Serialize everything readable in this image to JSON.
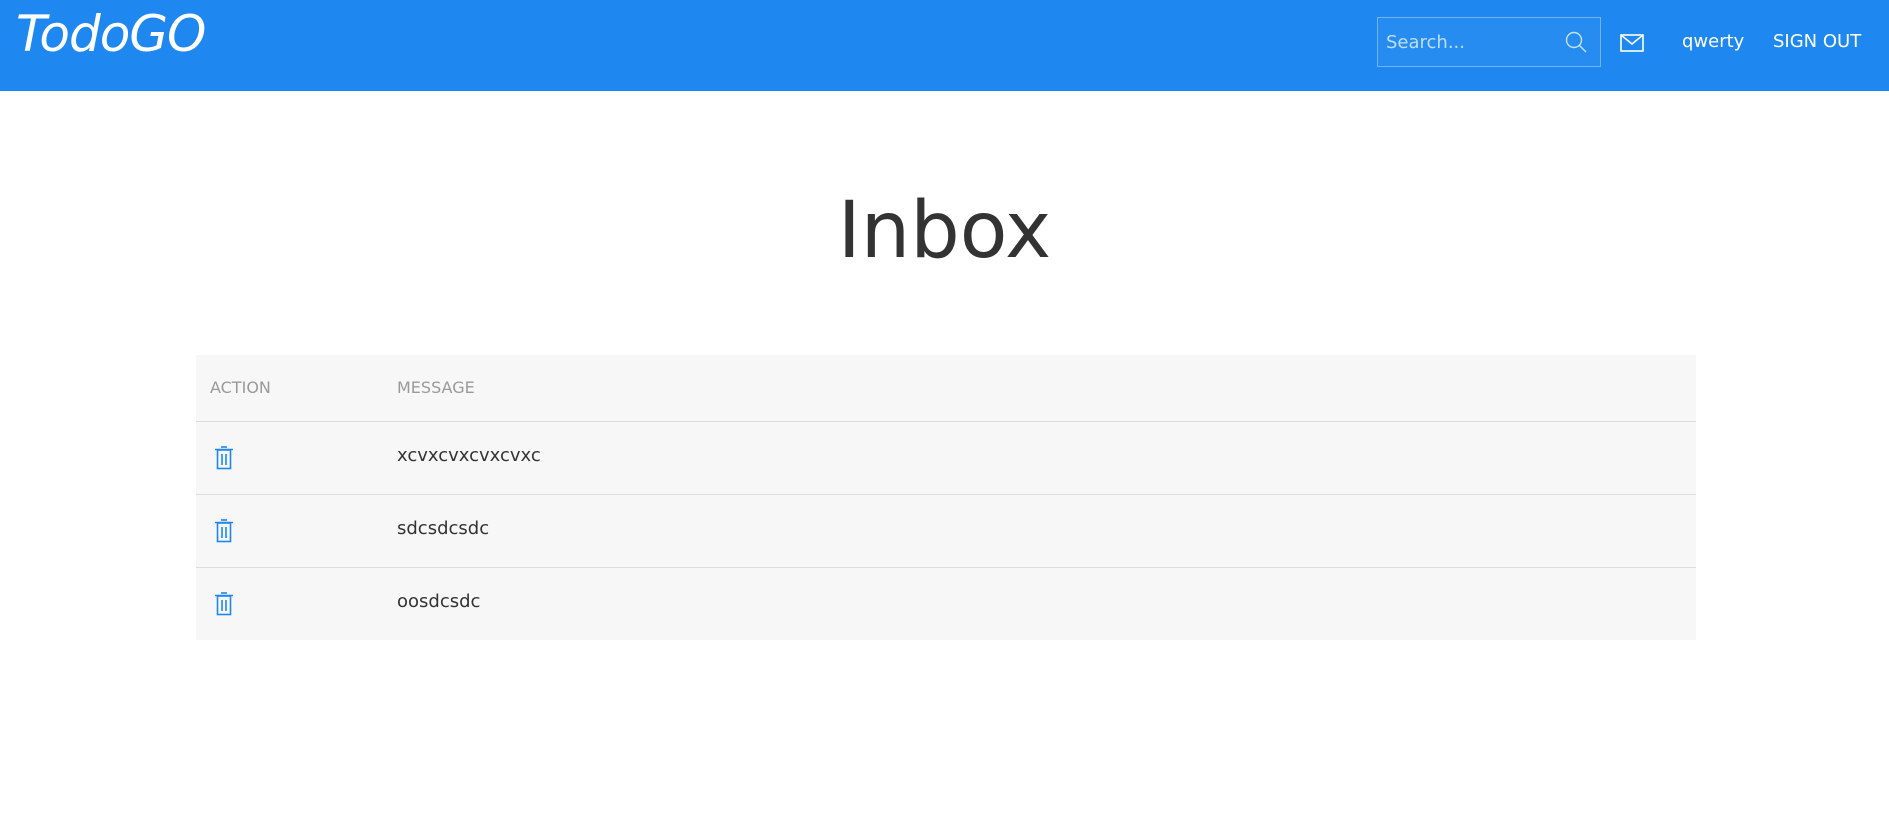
{
  "header": {
    "brand": "TodoGO",
    "search_placeholder": "Search...",
    "search_icon": "search-icon",
    "mail_icon": "mail-icon",
    "username": "qwerty",
    "signout_label": "SIGN OUT",
    "accent_color": "#1e88f0"
  },
  "main": {
    "title": "Inbox",
    "table": {
      "columns": [
        "ACTION",
        "MESSAGE"
      ],
      "rows": [
        {
          "action_icon": "trash-icon",
          "message": "xcvxcvxcvxcvxc"
        },
        {
          "action_icon": "trash-icon",
          "message": "sdcsdcsdc"
        },
        {
          "action_icon": "trash-icon",
          "message": "oosdcsdc"
        }
      ]
    }
  }
}
